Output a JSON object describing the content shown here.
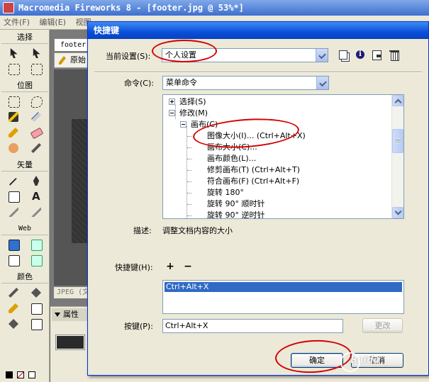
{
  "app": {
    "title": "Macromedia Fireworks 8 - [footer.jpg @  53%*]",
    "menu": [
      "文件(F)",
      "编辑(E)",
      "视图"
    ]
  },
  "tools": {
    "sections": [
      "选择",
      "位图",
      "矢量",
      "Web",
      "颜色"
    ]
  },
  "document": {
    "tab_label": "footer.",
    "view_button": "原始",
    "status": "JPEG (文",
    "properties_label": "属性"
  },
  "dialog": {
    "title": "快捷键",
    "current_set_label": "当前设置(S):",
    "current_set_value": "个人设置",
    "commands_label": "命令(C):",
    "commands_value": "菜单命令",
    "tree": [
      {
        "label": "选择(S)",
        "level": 0,
        "expander": "plus"
      },
      {
        "label": "修改(M)",
        "level": 0,
        "expander": "minus"
      },
      {
        "label": "画布(C)",
        "level": 1,
        "expander": "minus"
      },
      {
        "label": "图像大小(I)... (Ctrl+Alt+X)",
        "level": 2,
        "expander": "none"
      },
      {
        "label": "画布大小(C)...",
        "level": 2,
        "expander": "none"
      },
      {
        "label": "画布颜色(L)...",
        "level": 2,
        "expander": "none"
      },
      {
        "label": "修剪画布(T) (Ctrl+Alt+T)",
        "level": 2,
        "expander": "none"
      },
      {
        "label": "符合画布(F) (Ctrl+Alt+F)",
        "level": 2,
        "expander": "none"
      },
      {
        "label": "旋转 180°",
        "level": 2,
        "expander": "none"
      },
      {
        "label": "旋转 90° 顺时针",
        "level": 2,
        "expander": "none"
      },
      {
        "label": "旋转 90° 逆时针",
        "level": 2,
        "expander": "none"
      }
    ],
    "description_label": "描述:",
    "description_value": "调整文档内容的大小",
    "shortcuts_label": "快捷键(H):",
    "add_symbol": "+",
    "remove_symbol": "−",
    "shortcuts_list": [
      "Ctrl+Alt+X"
    ],
    "keys_label": "按键(P):",
    "keys_value": "Ctrl+Alt+X",
    "change_button": "更改",
    "ok_button": "确定",
    "cancel_button": "取消"
  },
  "watermark": "Baidu",
  "colors": {
    "selection": "#316ac5",
    "annotation": "#d40000",
    "titlebar": "#0a4fd8"
  }
}
